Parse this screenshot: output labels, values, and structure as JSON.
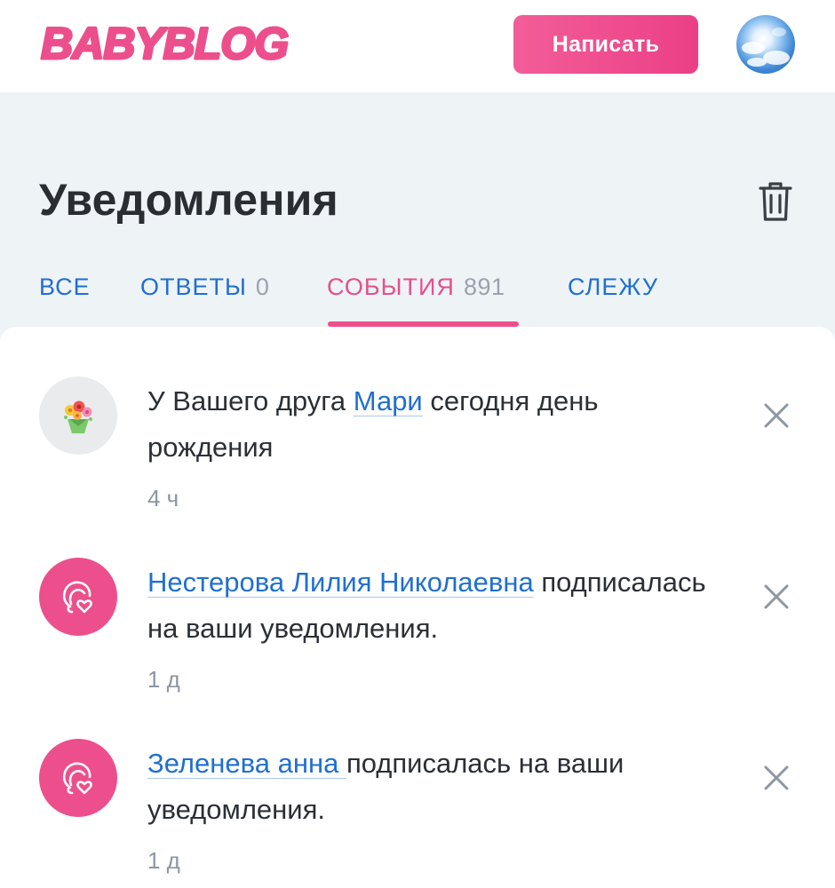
{
  "header": {
    "logo_text": "BABYBLOG",
    "write_button": "Написать",
    "brand_color": "#ec4f8c"
  },
  "page": {
    "title": "Уведомления"
  },
  "tabs": [
    {
      "label": "ВСЕ",
      "count": ""
    },
    {
      "label": "ОТВЕТЫ",
      "count": "0"
    },
    {
      "label": "СОБЫТИЯ",
      "count": "891",
      "active": true
    },
    {
      "label": "СЛЕЖУ",
      "count": ""
    }
  ],
  "notifications": [
    {
      "icon": "flower-bouquet-icon",
      "prefix": "У Вашего друга ",
      "link": "Мари",
      "suffix": " сегодня день рождения",
      "time": "4 ч"
    },
    {
      "icon": "subscriber-heart-icon",
      "prefix": "",
      "link": "Нестерова Лилия Николаевна",
      "suffix": " подписалась на ваши уведомления.",
      "time": "1 д"
    },
    {
      "icon": "subscriber-heart-icon",
      "prefix": "",
      "link": "Зеленева анна ",
      "suffix": "подписалась на ваши уведомления.",
      "time": "1 д"
    }
  ]
}
